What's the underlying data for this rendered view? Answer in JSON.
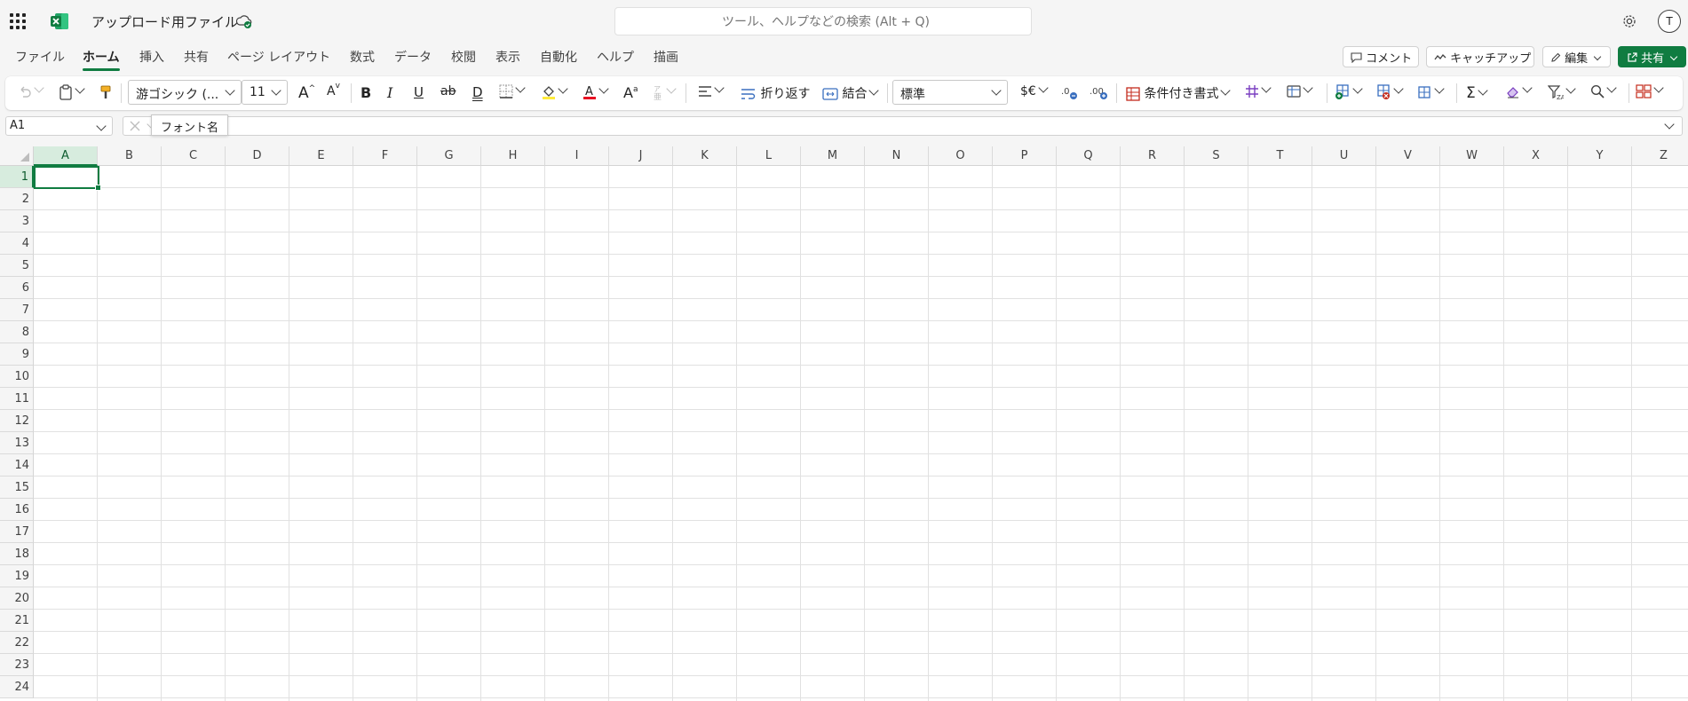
{
  "app": {
    "title": "アップロード用ファイル",
    "search_placeholder": "ツール、ヘルプなどの検索 (Alt + Q)",
    "avatar": "T"
  },
  "tabs": [
    "ファイル",
    "ホーム",
    "挿入",
    "共有",
    "ページ レイアウト",
    "数式",
    "データ",
    "校閲",
    "表示",
    "自動化",
    "ヘルプ",
    "描画"
  ],
  "active_tab": "ホーム",
  "top_actions": {
    "comment": "コメント",
    "catchup": "キャッチアップ",
    "edit": "編集",
    "share": "共有"
  },
  "ribbon": {
    "font_name": "游ゴシック (...",
    "font_size": "11",
    "wrap_text": "折り返す",
    "merge": "結合",
    "number_format": "標準",
    "conditional_format": "条件付き書式"
  },
  "tooltip": "フォント名",
  "name_box": "A1",
  "columns": [
    "A",
    "B",
    "C",
    "D",
    "E",
    "F",
    "G",
    "H",
    "I",
    "J",
    "K",
    "L",
    "M",
    "N",
    "O",
    "P",
    "Q",
    "R",
    "S",
    "T",
    "U",
    "V",
    "W",
    "X",
    "Y",
    "Z"
  ],
  "rows": [
    "1",
    "2",
    "3",
    "4",
    "5",
    "6",
    "7",
    "8",
    "9",
    "10",
    "11",
    "12",
    "13",
    "14",
    "15",
    "16",
    "17",
    "18",
    "19",
    "20",
    "21",
    "22",
    "23",
    "24"
  ],
  "selected_cell": "A1",
  "colors": {
    "accent": "#107c41",
    "selection_fill": "#d7ecde"
  }
}
